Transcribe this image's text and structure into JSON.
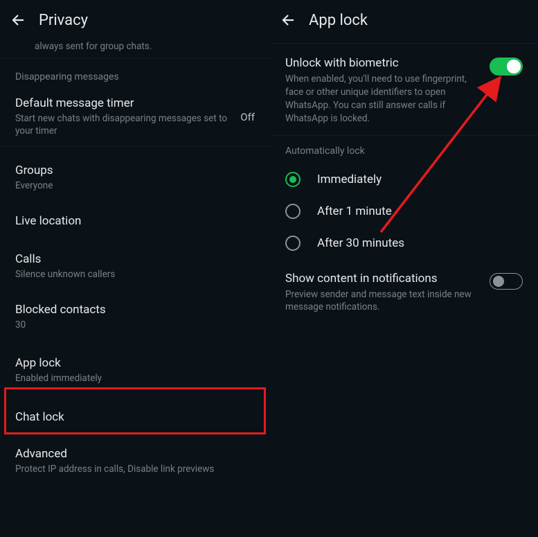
{
  "left": {
    "header_title": "Privacy",
    "truncated_desc": "always sent for group chats.",
    "disappearing_header": "Disappearing messages",
    "default_timer": {
      "title": "Default message timer",
      "sub": "Start new chats with disappearing messages set to your timer",
      "value": "Off"
    },
    "groups": {
      "title": "Groups",
      "sub": "Everyone"
    },
    "live_location": {
      "title": "Live location"
    },
    "calls": {
      "title": "Calls",
      "sub": "Silence unknown callers"
    },
    "blocked": {
      "title": "Blocked contacts",
      "sub": "30"
    },
    "app_lock": {
      "title": "App lock",
      "sub": "Enabled immediately"
    },
    "chat_lock": {
      "title": "Chat lock"
    },
    "advanced": {
      "title": "Advanced",
      "sub": "Protect IP address in calls, Disable link previews"
    }
  },
  "right": {
    "header_title": "App lock",
    "biometric": {
      "title": "Unlock with biometric",
      "desc": "When enabled, you'll need to use fingerprint, face or other unique identifiers to open WhatsApp. You can still answer calls if WhatsApp is locked."
    },
    "auto_lock_header": "Automatically lock",
    "options": {
      "immediately": "Immediately",
      "one_min": "After 1 minute",
      "thirty_min": "After 30 minutes"
    },
    "show_content": {
      "title": "Show content in notifications",
      "desc": "Preview sender and message text inside new message notifications."
    }
  }
}
